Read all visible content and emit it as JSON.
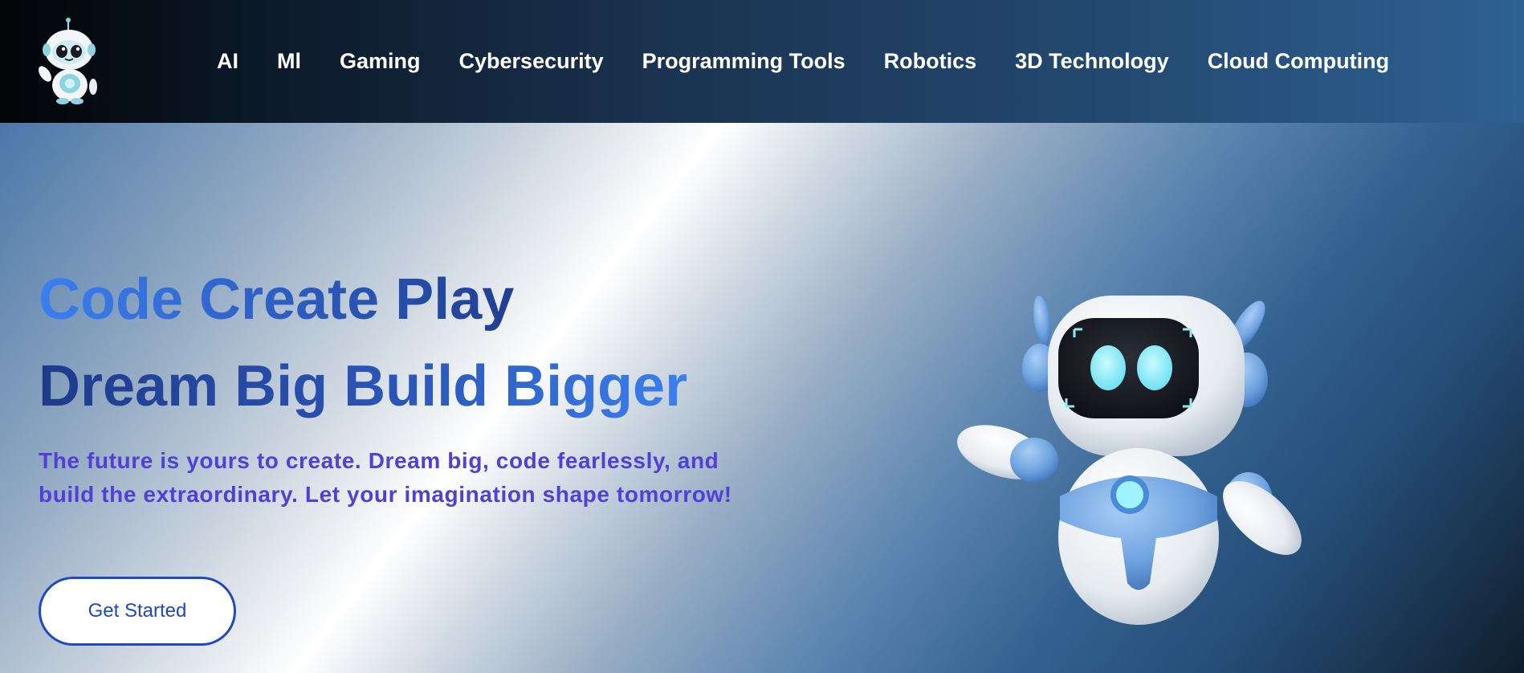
{
  "header": {
    "logo_icon": "robot-mascot-icon",
    "nav": [
      {
        "label": "AI"
      },
      {
        "label": "Ml"
      },
      {
        "label": "Gaming"
      },
      {
        "label": "Cybersecurity"
      },
      {
        "label": "Programming Tools"
      },
      {
        "label": "Robotics"
      },
      {
        "label": "3D Technology"
      },
      {
        "label": "Cloud Computing"
      }
    ]
  },
  "hero": {
    "headline_line1": "Code Create Play",
    "headline_line2": "Dream Big Build Bigger",
    "subtext": "The future is yours to create. Dream big, code fearlessly, and build the extraordinary. Let your imagination shape tomorrow!",
    "cta_label": "Get Started",
    "illustration_icon": "robot-illustration"
  },
  "colors": {
    "accent_blue": "#3b7ff0",
    "dark_blue": "#213f92",
    "subtext_purple": "#5140d6",
    "button_border": "#1f48c8"
  }
}
